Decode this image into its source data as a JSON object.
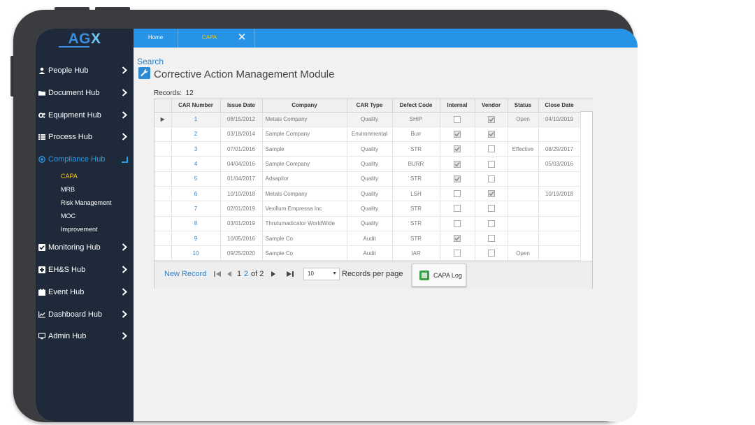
{
  "brand": {
    "logo_ag": "AG",
    "logo_x": "X"
  },
  "tabs": {
    "home": "Home",
    "capa": "CAPA",
    "close_glyph": "✕"
  },
  "sidebar": {
    "hubs": [
      {
        "label": "People Hub",
        "icon": "person-icon"
      },
      {
        "label": "Document Hub",
        "icon": "folder-icon"
      },
      {
        "label": "Equipment Hub",
        "icon": "gears-icon"
      },
      {
        "label": "Process Hub",
        "icon": "list-icon"
      },
      {
        "label": "Compliance Hub",
        "icon": "target-icon"
      },
      {
        "label": "Monitoring Hub",
        "icon": "checkbox-icon"
      },
      {
        "label": "EH&S Hub",
        "icon": "plus-square-icon"
      },
      {
        "label": "Event Hub",
        "icon": "calendar-icon"
      },
      {
        "label": "Dashboard Hub",
        "icon": "chart-icon"
      },
      {
        "label": "Admin Hub",
        "icon": "monitor-icon"
      }
    ],
    "compliance_sub": [
      "CAPA",
      "MRB",
      "Risk Management",
      "MOC",
      "Improvement"
    ]
  },
  "page": {
    "search_link": "Search",
    "title": "Corrective Action Management Module",
    "records_label": "Records:",
    "records_count": "12"
  },
  "grid": {
    "columns": [
      "CAR Number",
      "Issue Date",
      "Company",
      "CAR Type",
      "Defect Code",
      "Internal",
      "Vendor",
      "Status",
      "Close Date"
    ],
    "rows": [
      {
        "car": "1",
        "issue": "08/15/2012",
        "company": "Metals Company",
        "type": "Quality",
        "defect": "SHIP",
        "internal": false,
        "vendor": true,
        "status": "Open",
        "close": "04/10/2019"
      },
      {
        "car": "2",
        "issue": "03/18/2014",
        "company": "Sample Company",
        "type": "Environmental",
        "defect": "Burr",
        "internal": true,
        "vendor": true,
        "status": "",
        "close": ""
      },
      {
        "car": "3",
        "issue": "07/01/2016",
        "company": "Sample",
        "type": "Quality",
        "defect": "STR",
        "internal": true,
        "vendor": false,
        "status": "Effective",
        "close": "08/29/2017"
      },
      {
        "car": "4",
        "issue": "04/04/2016",
        "company": "Sample Company",
        "type": "Quality",
        "defect": "BURR",
        "internal": true,
        "vendor": false,
        "status": "",
        "close": "05/03/2016"
      },
      {
        "car": "5",
        "issue": "01/04/2017",
        "company": "Adsapilor",
        "type": "Quality",
        "defect": "STR",
        "internal": true,
        "vendor": false,
        "status": "",
        "close": ""
      },
      {
        "car": "6",
        "issue": "10/10/2018",
        "company": "Metals Company",
        "type": "Quality",
        "defect": "LSH",
        "internal": false,
        "vendor": true,
        "status": "",
        "close": "10/19/2018"
      },
      {
        "car": "7",
        "issue": "02/01/2019",
        "company": "Vexillum Empressa Inc",
        "type": "Quality",
        "defect": "STR",
        "internal": false,
        "vendor": false,
        "status": "",
        "close": ""
      },
      {
        "car": "8",
        "issue": "03/01/2019",
        "company": "Thrutumadicator WorldWide",
        "type": "Quality",
        "defect": "STR",
        "internal": false,
        "vendor": false,
        "status": "",
        "close": ""
      },
      {
        "car": "9",
        "issue": "10/05/2016",
        "company": "Sample Co",
        "type": "Audit",
        "defect": "STR",
        "internal": true,
        "vendor": false,
        "status": "",
        "close": ""
      },
      {
        "car": "10",
        "issue": "09/25/2020",
        "company": "Sample Co",
        "type": "Audit",
        "defect": "IAR",
        "internal": false,
        "vendor": false,
        "status": "Open",
        "close": ""
      }
    ],
    "selected_row": 0
  },
  "pager": {
    "new_record": "New Record",
    "page_current": "1",
    "page_other": "2",
    "of_label": "of 2",
    "page_size": "10",
    "records_per_page": "Records per page",
    "capa_log": "CAPA Log"
  }
}
